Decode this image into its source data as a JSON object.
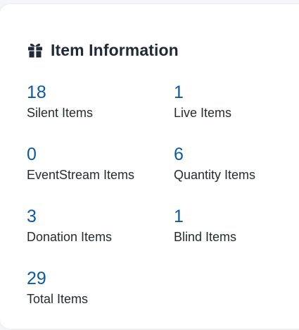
{
  "card": {
    "title": "Item Information",
    "icon": "gift-icon"
  },
  "stats": [
    {
      "value": "18",
      "label": "Silent Items"
    },
    {
      "value": "1",
      "label": "Live Items"
    },
    {
      "value": "0",
      "label": "EventStream Items"
    },
    {
      "value": "6",
      "label": "Quantity Items"
    },
    {
      "value": "3",
      "label": "Donation Items"
    },
    {
      "value": "1",
      "label": "Blind Items"
    },
    {
      "value": "29",
      "label": "Total Items"
    }
  ],
  "colors": {
    "value": "#0b5aa5",
    "title": "#1f2937",
    "label": "#262b33",
    "background": "#f5f6f8",
    "card": "#ffffff"
  }
}
